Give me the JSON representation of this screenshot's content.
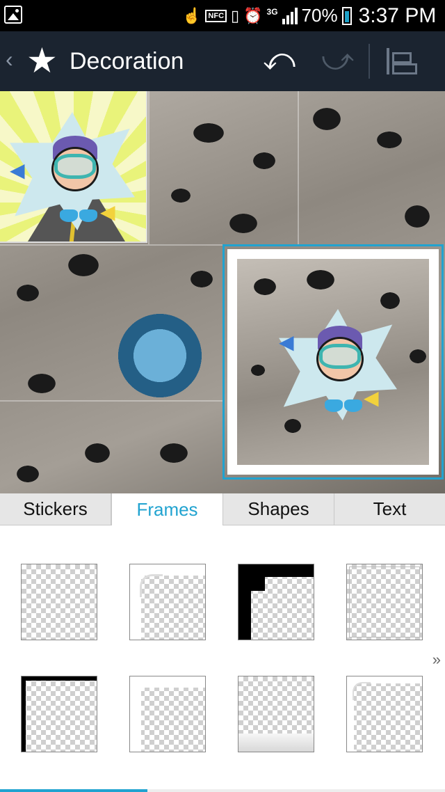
{
  "status_bar": {
    "nfc_label": "NFC",
    "network": "3G",
    "battery_percent": "70%",
    "time": "3:37 PM"
  },
  "action_bar": {
    "title": "Decoration",
    "back_glyph": "‹",
    "star_glyph": "★",
    "undo_glyph": "⤺",
    "redo_glyph": "⤻"
  },
  "tabs": [
    {
      "label": "Stickers",
      "active": false
    },
    {
      "label": "Frames",
      "active": true
    },
    {
      "label": "Shapes",
      "active": false
    },
    {
      "label": "Text",
      "active": false
    }
  ],
  "frames_panel": {
    "more_glyph": "»",
    "frame_count": 8
  },
  "colors": {
    "accent": "#21a3d0",
    "action_bar_bg": "#1b2430",
    "status_bar_bg": "#000000"
  },
  "icons": {
    "gallery": "gallery-icon",
    "touch": "touch-icon",
    "vibrate": "vibrate-icon",
    "alarm": "alarm-icon",
    "signal": "signal-icon",
    "battery": "battery-icon",
    "undo": "undo-icon",
    "redo": "redo-icon",
    "layers": "layers-icon"
  }
}
